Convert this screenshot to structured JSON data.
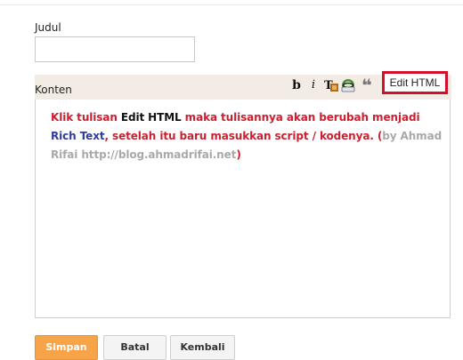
{
  "form": {
    "title_label": "Judul",
    "title_value": "",
    "content_label": "Konten"
  },
  "toolbar": {
    "bold_glyph": "b",
    "italic_glyph": "i",
    "edit_html_label": "Edit HTML",
    "highlight_color": "#d3102a"
  },
  "content": {
    "segments": [
      {
        "text": "Klik tulisan ",
        "color": "red"
      },
      {
        "text": "Edit HTML",
        "color": "black"
      },
      {
        "text": " maka tulisannya akan berubah menjadi ",
        "color": "red"
      },
      {
        "text": "Rich Text",
        "color": "blue"
      },
      {
        "text": ", setelah itu baru masukkan script / kodenya. (",
        "color": "red"
      },
      {
        "text": "by Ahmad Rifai http://blog.ahmadrifai.net",
        "color": "gray"
      },
      {
        "text": ")",
        "color": "red"
      }
    ]
  },
  "actions": {
    "save_label": "Simpan",
    "cancel_label": "Batal",
    "back_label": "Kembali"
  },
  "colors": {
    "save_button": "#f6a447",
    "text_red": "#cc1f30",
    "text_blue": "#2f3d9a",
    "text_gray": "#a9a9a9"
  }
}
